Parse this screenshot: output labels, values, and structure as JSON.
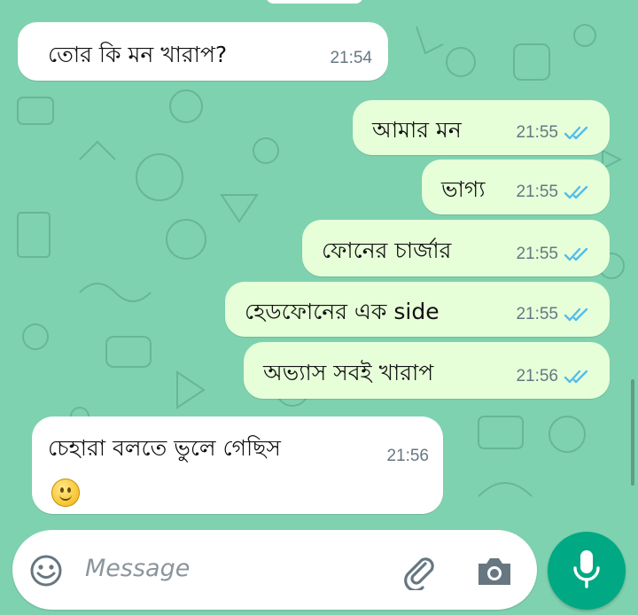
{
  "chat": {
    "messages": [
      {
        "direction": "incoming",
        "text": "তোর কি মন খারাপ?",
        "time": "21:54",
        "read": false
      },
      {
        "direction": "outgoing",
        "text": "আমার মন",
        "time": "21:55",
        "read": true
      },
      {
        "direction": "outgoing",
        "text": "ভাগ্য",
        "time": "21:55",
        "read": true
      },
      {
        "direction": "outgoing",
        "text": "ফোনের চার্জার",
        "time": "21:55",
        "read": true
      },
      {
        "direction": "outgoing",
        "text": "হেডফোনের এক side",
        "time": "21:55",
        "read": true
      },
      {
        "direction": "outgoing",
        "text": "অভ্যাস সবই খারাপ",
        "time": "21:56",
        "read": true
      },
      {
        "direction": "incoming",
        "text": "চেহারা বলতে ভুলে গেছিস",
        "time": "21:56",
        "read": false
      }
    ],
    "reaction_emoji": "slightly-smiling-face"
  },
  "composer": {
    "placeholder": "Message",
    "icons": [
      "emoji-icon",
      "attach-icon",
      "camera-icon",
      "mic-icon"
    ]
  },
  "colors": {
    "wallpaper": "#7fd2b0",
    "incoming_bubble": "#ffffff",
    "outgoing_bubble": "#e7ffd9",
    "read_tick": "#53bdeb",
    "send_button": "#00a884"
  }
}
